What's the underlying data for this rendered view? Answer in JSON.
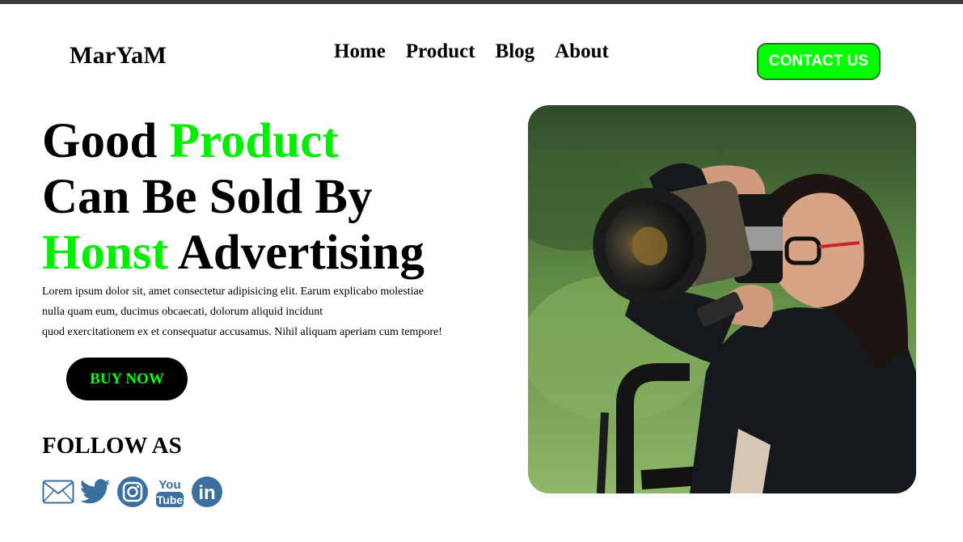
{
  "header": {
    "logo": "MarYaM",
    "nav": [
      "Home",
      "Product",
      "Blog",
      "About"
    ],
    "contact_label": "CONTACT US"
  },
  "hero": {
    "line1_a": "Good",
    "line1_b": "Product",
    "line2": "Can Be Sold By",
    "line3_a": "Honst",
    "line3_b": "Advertising",
    "body_lines": [
      "Lorem ipsum dolor sit, amet consectetur adipisicing elit. Earum explicabo molestiae",
      "nulla quam eum, ducimus obcaecati, dolorum aliquid incidunt",
      "quod exercitationem ex et consequatur accusamus. Nihil aliquam aperiam cum tempore!"
    ],
    "buy_label": "BUY NOW"
  },
  "follow": {
    "title": "FOLLOW AS",
    "icons": [
      "mail-icon",
      "twitter-icon",
      "instagram-icon",
      "youtube-icon",
      "linkedin-icon"
    ],
    "youtube_top": "You",
    "youtube_bottom": "Tube",
    "linkedin_text": "in"
  },
  "colors": {
    "accent": "#00ff00",
    "icon_blue": "#3b6fa0"
  }
}
